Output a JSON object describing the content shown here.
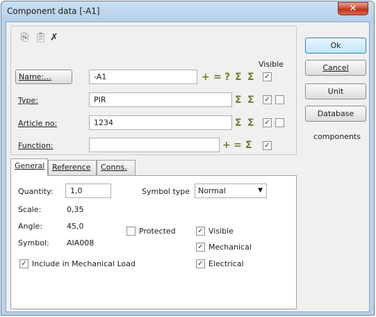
{
  "window": {
    "title": "Component data [-A1]",
    "close_glyph": "✕"
  },
  "toolbar": {
    "copy_icon": "copy-icon",
    "paste_icon": "paste-icon",
    "delete_icon": "delete-icon"
  },
  "header": {
    "visible_label": "Visible"
  },
  "fields": {
    "name": {
      "label": "Name:...",
      "value": "-A1"
    },
    "type": {
      "label": "Type:",
      "value": "PIR"
    },
    "article": {
      "label": "Article no:",
      "value": "1234"
    },
    "function": {
      "label": "Function:",
      "value": ""
    }
  },
  "symbols": {
    "plus": "+",
    "minus": "=",
    "question": "?",
    "sigma": "Σ",
    "sigma_pen": "Σ",
    "check": "✓"
  },
  "buttons": {
    "ok": "Ok",
    "cancel": "Cancel",
    "unit": "Unit",
    "database": "Database"
  },
  "components_label": "components",
  "tabs": [
    {
      "label": "General"
    },
    {
      "label": "Reference"
    },
    {
      "label": "Conns."
    }
  ],
  "general": {
    "quantity_label": "Quantity:",
    "quantity_value": "1,0",
    "symbol_type_label": "Symbol type",
    "symbol_type_value": "Normal",
    "scale_label": "Scale:",
    "scale_value": "0,35",
    "angle_label": "Angle:",
    "angle_value": "45,0",
    "symbol_label": "Symbol:",
    "symbol_value": "AIA008",
    "protected_label": "Protected",
    "visible_label": "Visible",
    "mechanical_label": "Mechanical",
    "electrical_label": "Electrical",
    "include_mech_label": "Include in Mechanical Load"
  }
}
